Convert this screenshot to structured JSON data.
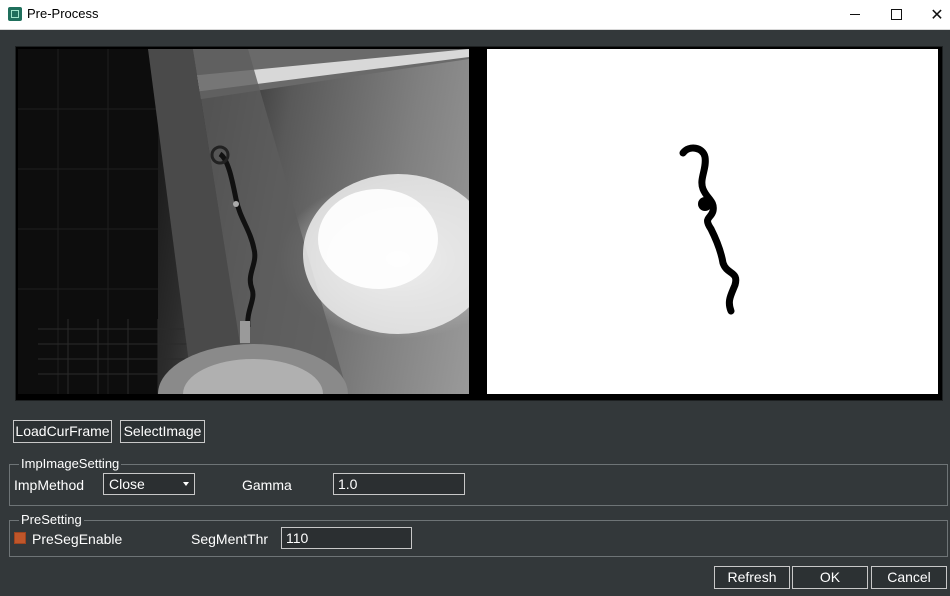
{
  "window": {
    "title": "Pre-Process",
    "icon": "app-icon",
    "controls": [
      "minimize",
      "maximize",
      "close"
    ]
  },
  "images": {
    "left": "grayscale-camera-frame",
    "right": "binary-segmentation-mask"
  },
  "buttons": {
    "load_cur_frame": "LoadCurFrame",
    "select_image": "SelectImage",
    "refresh": "Refresh",
    "ok": "OK",
    "cancel": "Cancel"
  },
  "imp_image_setting": {
    "title": "ImpImageSetting",
    "imp_method_label": "ImpMethod",
    "imp_method_value": "Close",
    "gamma_label": "Gamma",
    "gamma_value": "1.0"
  },
  "pre_setting": {
    "title": "PreSetting",
    "pre_seg_enable_label": "PreSegEnable",
    "pre_seg_enable_checked": true,
    "seg_ment_thr_label": "SegMentThr",
    "seg_ment_thr_value": "110"
  },
  "colors": {
    "background": "#33383a",
    "checkbox_accent": "#c0562a"
  }
}
